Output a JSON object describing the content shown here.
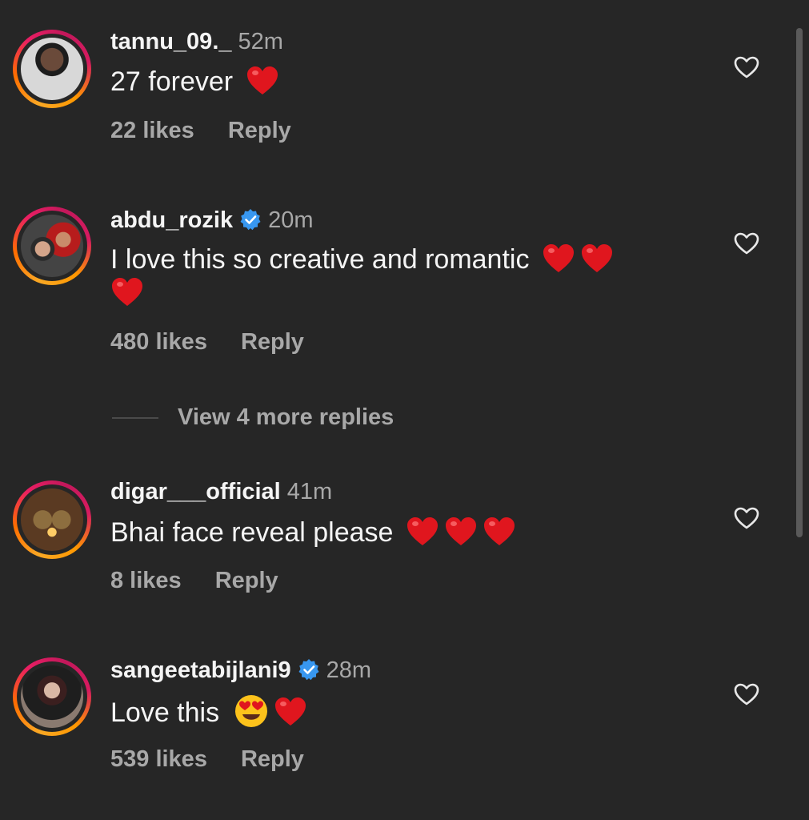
{
  "comments": [
    {
      "username": "tannu_09._",
      "time": "52m",
      "verified": false,
      "text": "27 forever",
      "emojis": [
        "red-heart"
      ],
      "likes": "22 likes",
      "reply": "Reply"
    },
    {
      "username": "abdu_rozik",
      "time": "20m",
      "verified": true,
      "text": "I love this so creative and romantic",
      "emojis": [
        "red-heart",
        "red-heart",
        "red-heart"
      ],
      "likes": "480 likes",
      "reply": "Reply"
    },
    {
      "username": "digar___official",
      "time": "41m",
      "verified": false,
      "text": "Bhai face reveal please",
      "emojis": [
        "red-heart",
        "red-heart",
        "red-heart"
      ],
      "likes": "8 likes",
      "reply": "Reply"
    },
    {
      "username": "sangeetabijlani9",
      "time": "28m",
      "verified": true,
      "text": "Love this",
      "emojis": [
        "heart-eyes-face",
        "red-heart"
      ],
      "likes": "539 likes",
      "reply": "Reply"
    }
  ],
  "view_more_replies": "View 4 more replies",
  "colors": {
    "background": "#262626",
    "primary_text": "#f5f5f5",
    "secondary_text": "#a8a8a8",
    "verified_blue": "#3897f0",
    "emoji_red": "#e0161e"
  }
}
